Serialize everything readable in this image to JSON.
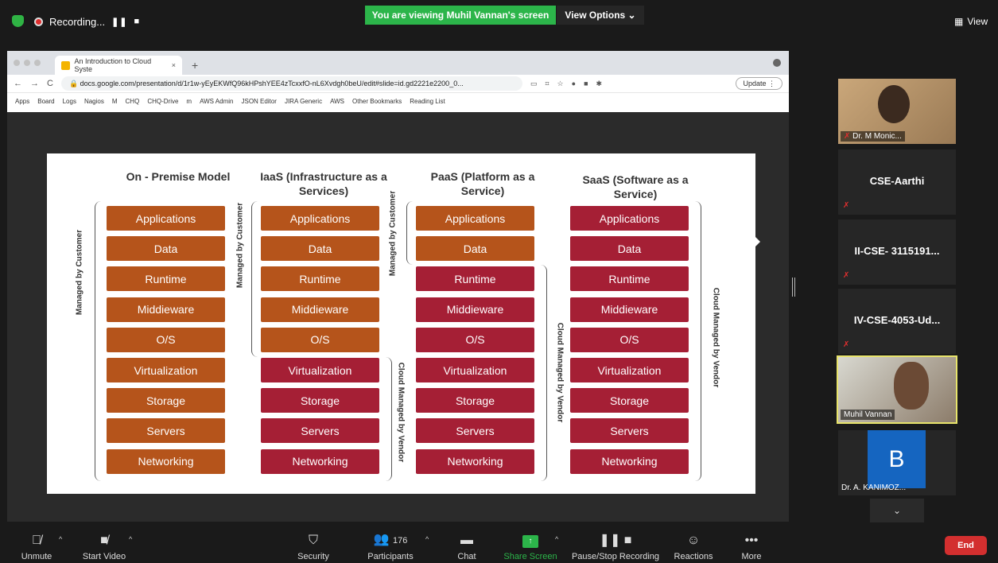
{
  "meeting": {
    "recording_label": "Recording...",
    "viewing_banner": "You are viewing Muhil Vannan's screen",
    "view_options": "View Options ⌄",
    "view_menu": "View"
  },
  "browser": {
    "tab_title": "An Introduction to Cloud Syste",
    "url": "docs.google.com/presentation/d/1r1w-yEyEKWfQ96kHPshYEE4zTcxxfO-nL6Xvdgh0beU/edit#slide=id.gd2221e2200_0...",
    "update_label": "Update",
    "bookmarks": [
      "Apps",
      "Board",
      "Logs",
      "Nagios",
      "M",
      "CHQ",
      "CHQ-Drive",
      "m",
      "AWS Admin",
      "JSON Editor",
      "JIRA Generic",
      "AWS",
      "Other Bookmarks",
      "Reading List"
    ]
  },
  "slide": {
    "columns": [
      {
        "title": "On - Premise Model"
      },
      {
        "title": "IaaS (Infrastructure as a Services)"
      },
      {
        "title": "PaaS (Platform as a Service)"
      },
      {
        "title": "SaaS (Software as a Service)"
      }
    ],
    "layers": [
      "Applications",
      "Data",
      "Runtime",
      "Middieware",
      "O/S",
      "Virtualization",
      "Storage",
      "Servers",
      "Networking"
    ],
    "label_customer": "Managed by Customer",
    "label_vendor": "Cloud Managed by Vendor",
    "colors": {
      "customer": "#b5541b",
      "vendor": "#a51f35"
    }
  },
  "participants_panel": [
    {
      "name": "Dr. M Monic..."
    },
    {
      "name": "CSE-Aarthi"
    },
    {
      "name": "II-CSE- 3115191..."
    },
    {
      "name": "IV-CSE-4053-Ud..."
    },
    {
      "name": "Muhil Vannan"
    },
    {
      "name": "Dr. A. KANIMOZ...",
      "initial": "B"
    }
  ],
  "toolbar": {
    "unmute": "Unmute",
    "start_video": "Start Video",
    "security": "Security",
    "participants": "Participants",
    "participants_count": "176",
    "chat": "Chat",
    "share_screen": "Share Screen",
    "pause_recording": "Pause/Stop Recording",
    "reactions": "Reactions",
    "more": "More",
    "end": "End"
  }
}
